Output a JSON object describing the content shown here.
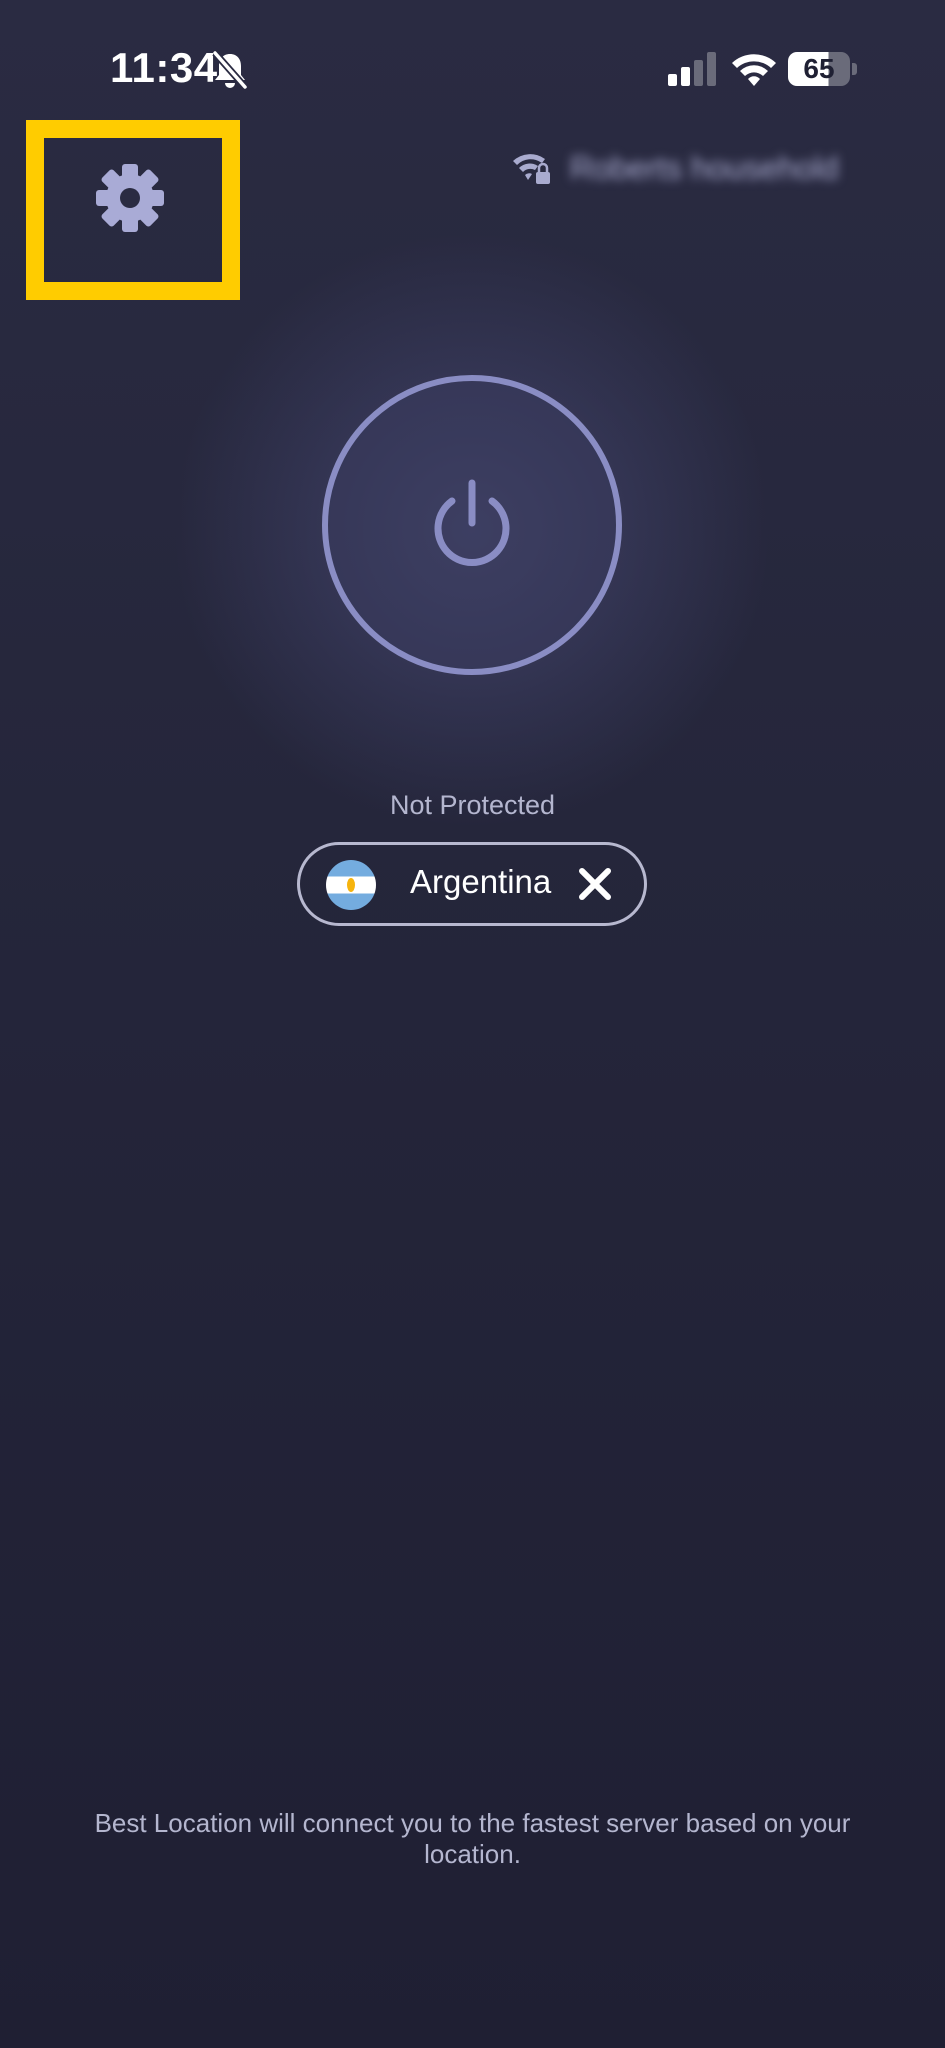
{
  "status_bar": {
    "time": "11:34",
    "battery": "65",
    "icons": [
      "bell-slash-icon",
      "cellular-signal-icon",
      "wifi-icon",
      "battery-icon"
    ]
  },
  "header": {
    "settings_icon": "gear-icon",
    "network_icon": "wifi-lock-icon",
    "network_name": "Roberts household"
  },
  "connection": {
    "power_icon": "power-icon",
    "status": "Not Protected"
  },
  "location": {
    "flag_icon": "argentina-flag-icon",
    "name": "Argentina",
    "clear_icon": "close-icon"
  },
  "footer": {
    "hint": "Best Location will connect you to the fastest server based on your location."
  },
  "colors": {
    "background": "#25263b",
    "accent": "#8a8dc4",
    "highlight": "#ffcc00",
    "muted_text": "#b4b6cf"
  }
}
